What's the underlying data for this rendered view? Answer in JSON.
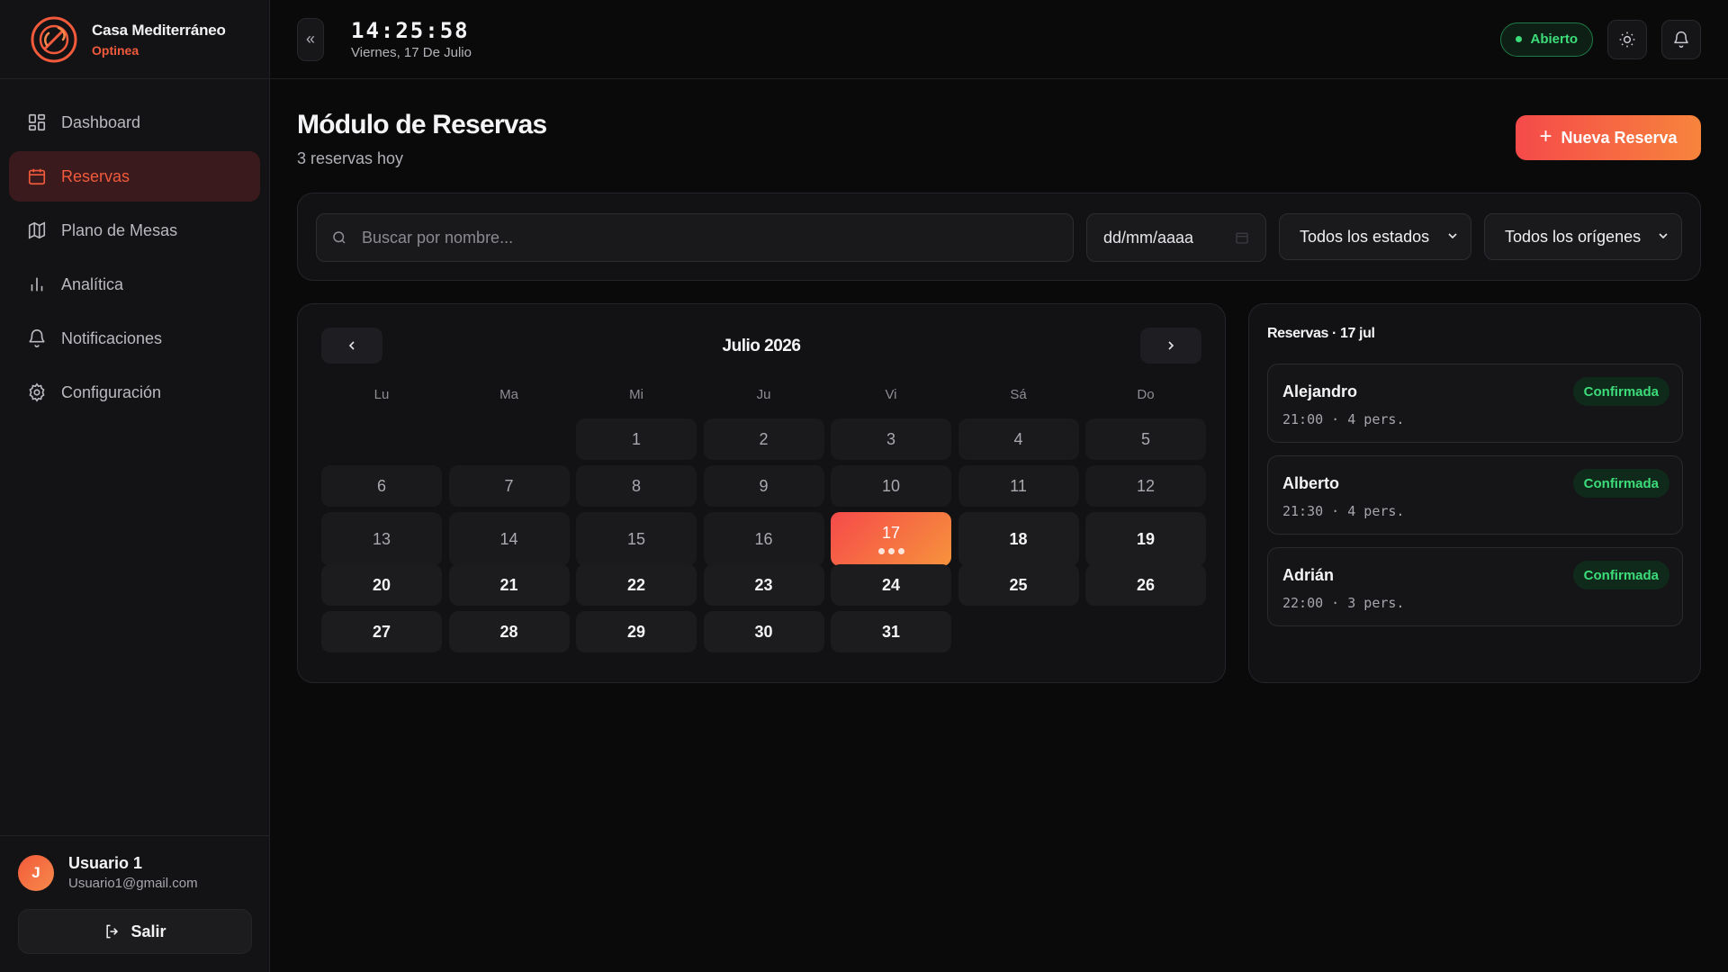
{
  "brand": {
    "name": "Casa Mediterráneo",
    "subtitle": "Optinea"
  },
  "nav": [
    {
      "id": "dashboard",
      "label": "Dashboard",
      "icon": "grid-icon",
      "active": false
    },
    {
      "id": "reservas",
      "label": "Reservas",
      "icon": "calendar-icon",
      "active": true
    },
    {
      "id": "plano",
      "label": "Plano de Mesas",
      "icon": "map-icon",
      "active": false
    },
    {
      "id": "analitica",
      "label": "Analítica",
      "icon": "bar-chart-icon",
      "active": false
    },
    {
      "id": "notificaciones",
      "label": "Notificaciones",
      "icon": "bell-icon",
      "active": false
    },
    {
      "id": "configuracion",
      "label": "Configuración",
      "icon": "gear-icon",
      "active": false
    }
  ],
  "user": {
    "initial": "J",
    "name": "Usuario 1",
    "email": "Usuario1@gmail.com",
    "logout_label": "Salir"
  },
  "topbar": {
    "collapse_glyph": "«",
    "time": "14:25:58",
    "date": "Viernes, 17 De Julio",
    "status": "Abierto"
  },
  "page": {
    "title": "Módulo de Reservas",
    "subtitle": "3 reservas hoy",
    "new_button": "Nueva Reserva"
  },
  "filters": {
    "search_placeholder": "Buscar por nombre...",
    "date_placeholder": "dd/mm/aaaa",
    "status_select": "Todos los estados",
    "origin_select": "Todos los orígenes"
  },
  "calendar": {
    "title": "Julio 2026",
    "weekdays": [
      "Lu",
      "Ma",
      "Mi",
      "Ju",
      "Vi",
      "Sá",
      "Do"
    ],
    "first_weekday_index": 2,
    "days_in_month": 31,
    "today": 17,
    "reservation_dots_today": 3
  },
  "list": {
    "title": "Reservas · 17 jul",
    "items": [
      {
        "name": "Alejandro",
        "meta": "21:00 · 4 pers.",
        "status": "Confirmada"
      },
      {
        "name": "Alberto",
        "meta": "21:30 · 4 pers.",
        "status": "Confirmada"
      },
      {
        "name": "Adrián",
        "meta": "22:00 · 3 pers.",
        "status": "Confirmada"
      }
    ]
  },
  "colors": {
    "accent": "#f25a3c",
    "accent_gradient_end": "#f7933c",
    "success": "#3ddc7a",
    "background": "#0a0a0b",
    "panel": "#121214"
  }
}
